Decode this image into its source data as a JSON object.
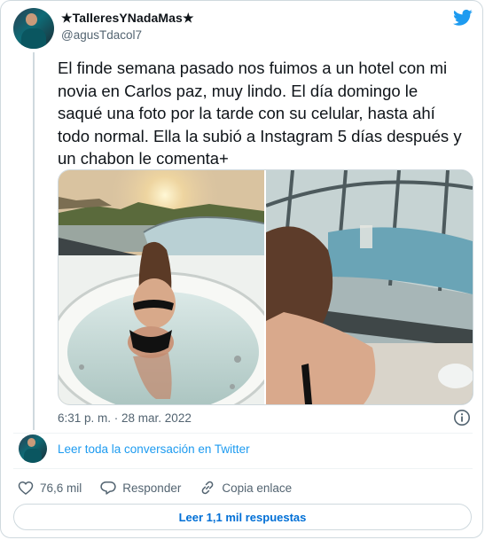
{
  "author": {
    "name": "★TalleresYNadaMas★",
    "handle": "@agusTdacol7"
  },
  "tweet": {
    "text": "El finde semana pasado nos fuimos a un hotel con mi novia en Carlos paz, muy lindo. El día domingo le saqué una foto por la tarde con su celular, hasta ahí todo normal. Ella la subió a Instagram 5 días después y un chabon le comenta+",
    "timestamp": "6:31 p. m. · 28 mar. 2022"
  },
  "conversation_link": "Leer toda la conversación en Twitter",
  "actions": {
    "likes": "76,6 mil",
    "reply": "Responder",
    "copy_link": "Copia enlace"
  },
  "read_replies": "Leer 1,1 mil respuestas",
  "colors": {
    "twitter_blue": "#1d9bf0",
    "text_primary": "#0f1419",
    "text_secondary": "#536471",
    "border": "#cfd9de",
    "reply_button_text": "#006fd6"
  }
}
